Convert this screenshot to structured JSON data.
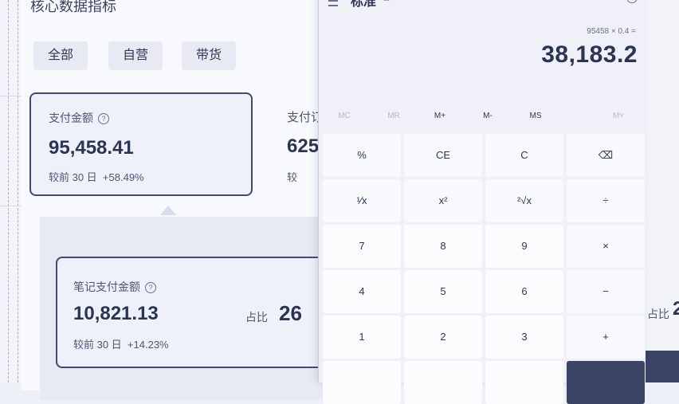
{
  "dashboard": {
    "title": "核心数据指标",
    "tabs": [
      "全部",
      "自营",
      "带货"
    ],
    "card_main": {
      "label": "支付金额",
      "value": "95,458.41",
      "compare": "较前 30 日",
      "change": "+58.49%"
    },
    "card_partial": {
      "label": "支付订",
      "value": "625",
      "compare": "较"
    },
    "card_sub": {
      "label": "笔记支付金额",
      "value": "10,821.13",
      "compare": "较前 30 日",
      "change": "+14.23%",
      "ratio_label": "占比",
      "ratio_value": "26"
    },
    "right_partial": {
      "ratio_label": "占比",
      "ratio_value": "2"
    }
  },
  "calculator": {
    "title": "标准",
    "mode_icon": "keep-on-top-icon",
    "history_icon": "history-icon",
    "expression": "95458 × 0.4 =",
    "display": "38,183.2",
    "memory": [
      "MC",
      "MR",
      "M+",
      "M-",
      "MS",
      "M˅"
    ],
    "memory_enabled": [
      false,
      false,
      true,
      true,
      true,
      false
    ],
    "keys": [
      [
        "%",
        "CE",
        "C",
        "⌫"
      ],
      [
        "¹⁄x",
        "x²",
        "²√x",
        "÷"
      ],
      [
        "7",
        "8",
        "9",
        "×"
      ],
      [
        "4",
        "5",
        "6",
        "−"
      ],
      [
        "1",
        "2",
        "3",
        "+"
      ]
    ]
  },
  "colors": {
    "accent": "#3a4566",
    "card_border": "#3e4a72",
    "background": "#f3f4fa"
  }
}
